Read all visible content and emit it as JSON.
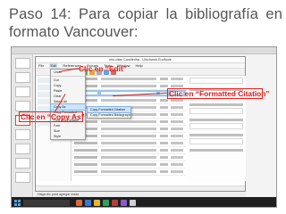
{
  "slide": {
    "title_line1": "Paso 14: Para copiar la bibliografía en",
    "title_line2": "formato Vancouver:"
  },
  "app": {
    "window_title": "mis.citas Camilintha - Ulrichweb EndNote",
    "menu": [
      "File",
      "Edit",
      "References",
      "Groups",
      "Tools",
      "Window",
      "Help"
    ],
    "edit_menu": [
      "Undo",
      "Cut",
      "Copy",
      "Paste",
      "Clear",
      "Select All",
      "Copy As",
      "Copy Formatted",
      "Find and Replace",
      "Font",
      "Size",
      "Style"
    ],
    "copy_submenu": [
      "Copy Formatted Citation",
      "Copy Formatted Bibliography"
    ],
    "highlighted_row": 2,
    "row_count": 14,
    "notes_placeholder": "Haga clic para agregar notas"
  },
  "callouts": {
    "edit": "Clic en “Edit”",
    "copy_as": "Clic en “Copy As”",
    "formatted_citation": "Clic en “Formatted Citation”"
  },
  "colors": {
    "title": "#555555",
    "callout": "#e2211c",
    "highlight": "#9ac3ea",
    "taskbar": "#1f1f1f"
  },
  "icons": [
    "windows-start-icon",
    "search-box",
    "taskbar-app-icon"
  ]
}
